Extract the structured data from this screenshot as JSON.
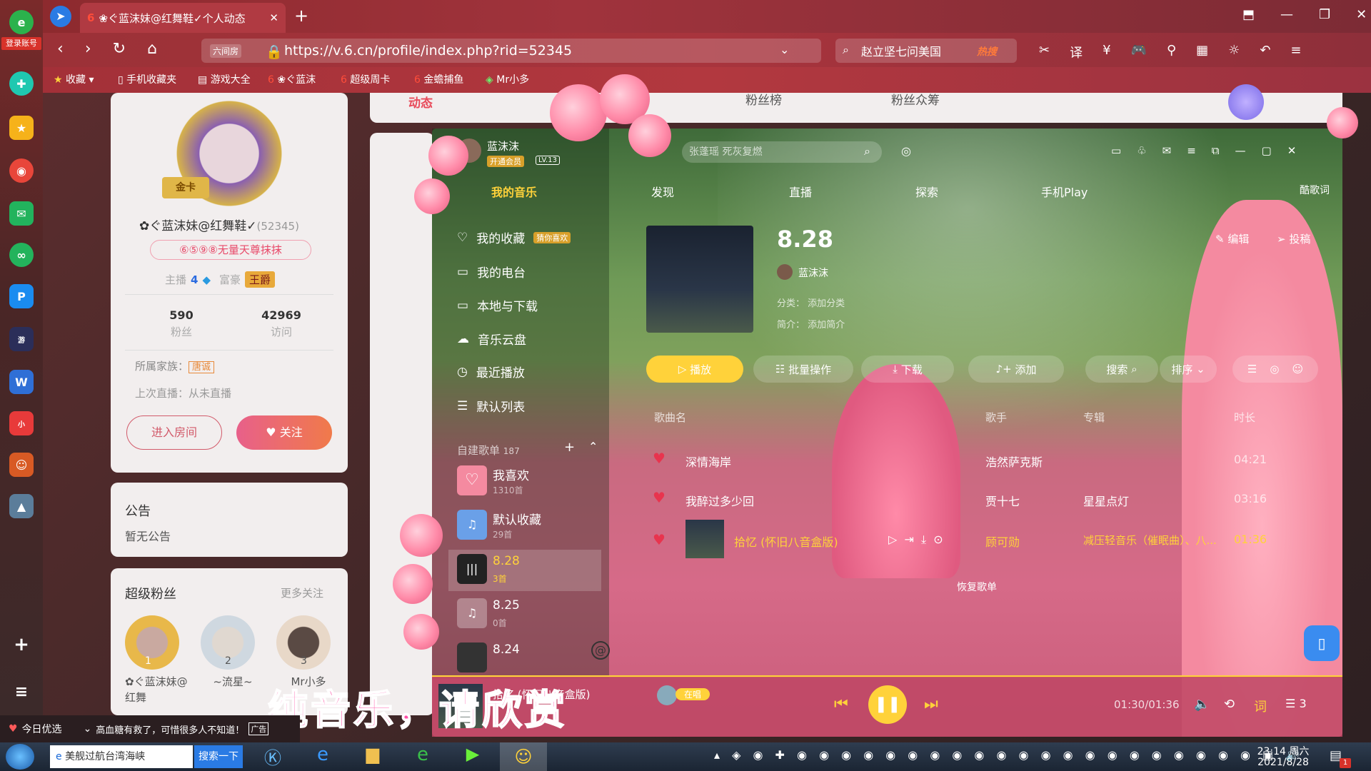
{
  "sidebar_left": {
    "login": "登录账号",
    "icons": [
      "ie-logo-icon",
      "speedial-icon",
      "favorites-icon",
      "weibo-icon",
      "mail-icon",
      "sync-icon",
      "pinyin-icon",
      "game-icon",
      "word-icon",
      "mi-icon",
      "avatar-game-icon",
      "pubg-icon",
      "add-icon",
      "menu-icon"
    ]
  },
  "browser": {
    "tab_title": "❀ぐ蓝沫妹@红舞鞋✓个人动态",
    "url": "https://v.6.cn/profile/index.php?rid=52345",
    "url_badge": "六间房",
    "search_text": "赵立坚七问美国",
    "search_badge": "热搜",
    "bookmarks": [
      "收藏",
      "手机收藏夹",
      "游戏大全",
      "❀ぐ蓝沫",
      "超级周卡",
      "金蟾捕鱼",
      "Mr小多"
    ]
  },
  "profile": {
    "name": "✿ぐ蓝沫妹@红舞鞋✓",
    "rid": "(52345)",
    "badge_text": "⑥⑤⑨⑧无量天尊抹抹",
    "anchor_label": "主播",
    "anchor_level": "4",
    "rich_label": "富豪",
    "rich_title": "王爵",
    "fans_count": "590",
    "fans_label": "粉丝",
    "visits_count": "42969",
    "visits_label": "访问",
    "family_label": "所属家族：",
    "family_value": "唐诚",
    "last_live": "上次直播：从未直播",
    "enter_room": "进入房间",
    "follow": "关注",
    "card_label": "金卡"
  },
  "notice": {
    "title": "公告",
    "content": "暂无公告"
  },
  "super_fans": {
    "title": "超级粉丝",
    "more": "更多关注",
    "fans": [
      {
        "rank": "1",
        "name": "✿ぐ蓝沫妹@红舞"
      },
      {
        "rank": "2",
        "name": "~流星~"
      },
      {
        "rank": "3",
        "name": "Mr小多"
      }
    ]
  },
  "page_tabs": {
    "t1": "动态",
    "t2": "粉丝榜",
    "t3": "粉丝众筹"
  },
  "music": {
    "user": "蓝沫沫",
    "vip": "开通会员",
    "level": "LV.13",
    "search_placeholder": "张蓬瑶 死灰复燃",
    "nav": [
      "我的音乐",
      "发现",
      "直播",
      "探索",
      "手机Play",
      "酷歌词"
    ],
    "menu": [
      "我的收藏",
      "我的电台",
      "本地与下载",
      "音乐云盘",
      "最近播放",
      "默认列表"
    ],
    "guess_tag": "猜你喜欢",
    "playlists_title": "自建歌单",
    "playlists_count": "187",
    "playlists": [
      {
        "name": "我喜欢",
        "count": "1310首"
      },
      {
        "name": "默认收藏",
        "count": "29首"
      },
      {
        "name": "8.28",
        "count": "3首"
      },
      {
        "name": "8.25",
        "count": "0首"
      },
      {
        "name": "8.24",
        "count": ""
      }
    ],
    "album": {
      "title": "8.28",
      "owner": "蓝沫沫",
      "category": "分类：  添加分类",
      "intro": "简介：  添加简介",
      "edit": "编辑",
      "share": "投稿"
    },
    "actions": {
      "play": "播放",
      "batch": "批量操作",
      "download": "下载",
      "add": "添加",
      "search": "搜索",
      "sort": "排序"
    },
    "columns": {
      "name": "歌曲名",
      "artist": "歌手",
      "album": "专辑",
      "duration": "时长"
    },
    "songs": [
      {
        "name": "深情海岸",
        "artist": "浩然萨克斯",
        "album": "",
        "duration": "04:21"
      },
      {
        "name": "我醉过多少回",
        "artist": "贾十七",
        "album": "星星点灯",
        "duration": "03:16"
      },
      {
        "name": "拾忆 (怀旧八音盒版)",
        "artist": "顾可勋",
        "album": "减压轻音乐（催眠曲）、八...",
        "duration": "01:36"
      }
    ],
    "restore": "恢复歌单",
    "now_playing": "拾忆 (怀旧八音盒版)",
    "live_tag": "在唱",
    "time": "01:30/01:36",
    "lyrics": "词",
    "queue_count": "3"
  },
  "subtitle": "纯音乐，请欣赏",
  "news": {
    "label": "今日优选",
    "text": "高血糖有救了，可惜很多人不知道！",
    "ad": "广告"
  },
  "taskbar": {
    "ie_title": "美舰过航台湾海峡",
    "search_btn": "搜索一下",
    "time": "23:14 周六",
    "date": "2021/8/28",
    "badge": "1"
  }
}
